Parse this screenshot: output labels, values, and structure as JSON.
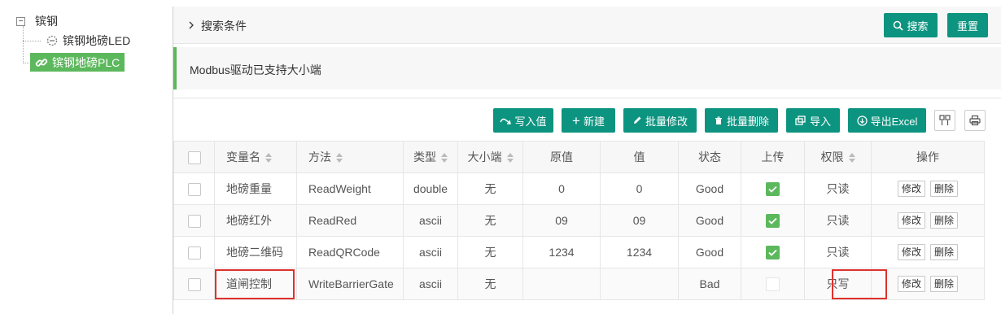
{
  "tree": {
    "root_label": "镔钢",
    "children": [
      {
        "label": "镔钢地磅LED"
      },
      {
        "label": "镔钢地磅PLC"
      }
    ]
  },
  "search": {
    "title": "搜索条件",
    "search_label": "搜索",
    "reset_label": "重置"
  },
  "notice": "Modbus驱动已支持大小端",
  "toolbar": {
    "write_value": "写入值",
    "new": "新建",
    "batch_edit": "批量修改",
    "batch_delete": "批量删除",
    "import": "导入",
    "export": "导出Excel"
  },
  "table": {
    "headers": [
      "变量名",
      "方法",
      "类型",
      "大小端",
      "原值",
      "值",
      "状态",
      "上传",
      "权限",
      "操作"
    ],
    "rows": [
      {
        "name": "地磅重量",
        "method": "ReadWeight",
        "type": "double",
        "endian": "无",
        "raw": "0",
        "value": "0",
        "status": "Good",
        "upload": true,
        "perm": "只读"
      },
      {
        "name": "地磅红外",
        "method": "ReadRed",
        "type": "ascii",
        "endian": "无",
        "raw": "09",
        "value": "09",
        "status": "Good",
        "upload": true,
        "perm": "只读"
      },
      {
        "name": "地磅二维码",
        "method": "ReadQRCode",
        "type": "ascii",
        "endian": "无",
        "raw": "1234",
        "value": "1234",
        "status": "Good",
        "upload": true,
        "perm": "只读"
      },
      {
        "name": "道闸控制",
        "method": "WriteBarrierGate",
        "type": "ascii",
        "endian": "无",
        "raw": "",
        "value": "",
        "status": "Bad",
        "upload": false,
        "perm": "只写"
      }
    ],
    "edit_label": "修改",
    "delete_label": "删除"
  },
  "colors": {
    "primary": "#0d9480",
    "selected_node": "#5cb85c",
    "highlight": "#e0312d"
  }
}
